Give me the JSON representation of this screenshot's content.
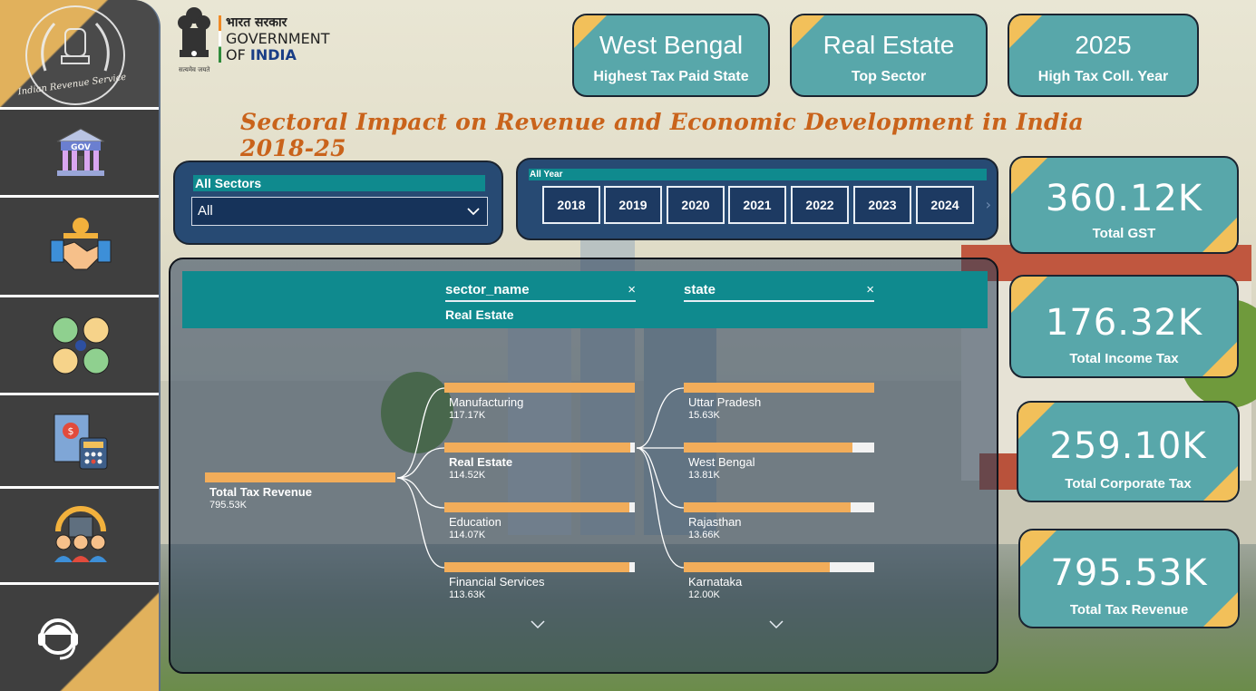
{
  "sidebar": {
    "logo_text": "Indian Revenue Service",
    "items": [
      {
        "icon": "government-building-icon",
        "label": "GOV"
      },
      {
        "icon": "handshake-icon"
      },
      {
        "icon": "sectors-icon"
      },
      {
        "icon": "tax-calculator-icon"
      },
      {
        "icon": "citizens-icon"
      },
      {
        "icon": "support-agent-icon"
      }
    ]
  },
  "goi": {
    "hindi": "भारत सरकार",
    "line1": "GOVERNMENT",
    "line2_prefix": "OF ",
    "line2_bold": "INDIA",
    "motto": "सत्यमेव जयते"
  },
  "top_cards": [
    {
      "value": "West Bengal",
      "label": "Highest Tax Paid State"
    },
    {
      "value": "Real Estate",
      "label": "Top Sector"
    },
    {
      "value": "2025",
      "label": "High Tax Coll. Year"
    }
  ],
  "title": "Sectoral Impact on Revenue and Economic Development in India 2018-25",
  "sector_slicer": {
    "header": "All Sectors",
    "selected": "All"
  },
  "year_slicer": {
    "header": "All Year",
    "years": [
      "2018",
      "2019",
      "2020",
      "2021",
      "2022",
      "2023",
      "2024"
    ]
  },
  "kpis": [
    {
      "value": "360.12K",
      "label": "Total GST"
    },
    {
      "value": "176.32K",
      "label": "Total Income Tax"
    },
    {
      "value": "259.10K",
      "label": "Total Corporate Tax"
    },
    {
      "value": "795.53K",
      "label": "Total Tax Revenue"
    }
  ],
  "tree": {
    "levels": [
      {
        "field": "sector_name",
        "selected": "Real Estate"
      },
      {
        "field": "state",
        "selected": ""
      }
    ],
    "root": {
      "name": "Total Tax Revenue",
      "value": "795.53K",
      "fill": 1.0
    },
    "sectors": [
      {
        "name": "Manufacturing",
        "value": "117.17K",
        "fill": 1.0
      },
      {
        "name": "Real Estate",
        "value": "114.52K",
        "fill": 0.977
      },
      {
        "name": "Education",
        "value": "114.07K",
        "fill": 0.973
      },
      {
        "name": "Financial Services",
        "value": "113.63K",
        "fill": 0.97
      }
    ],
    "states": [
      {
        "name": "Uttar Pradesh",
        "value": "15.63K",
        "fill": 1.0
      },
      {
        "name": "West Bengal",
        "value": "13.81K",
        "fill": 0.884
      },
      {
        "name": "Rajasthan",
        "value": "13.66K",
        "fill": 0.874
      },
      {
        "name": "Karnataka",
        "value": "12.00K",
        "fill": 0.768
      }
    ]
  }
}
